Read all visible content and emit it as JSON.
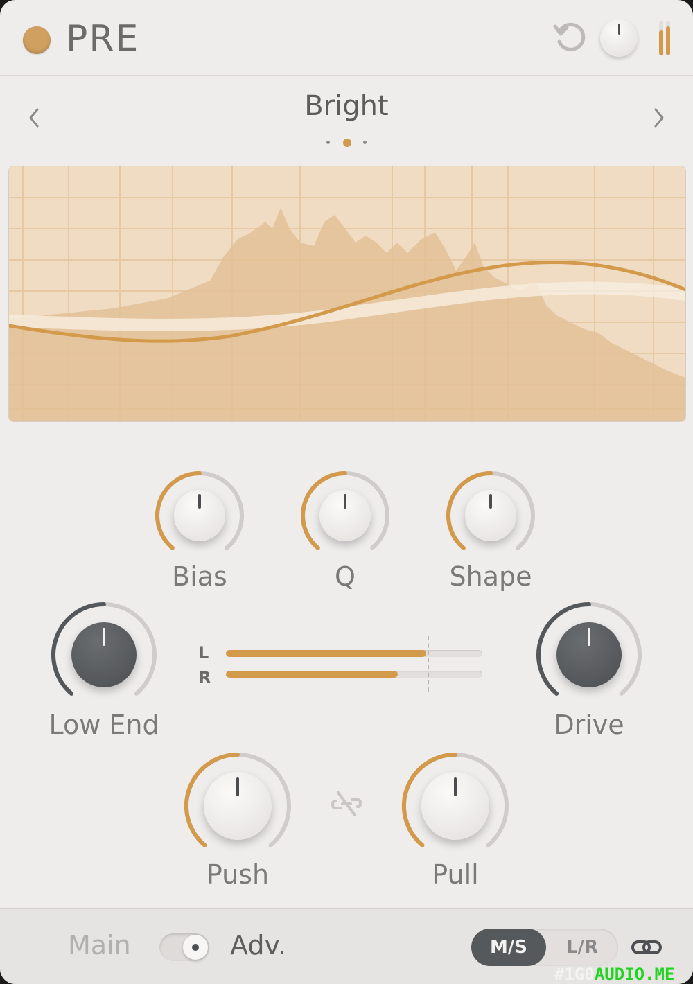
{
  "header": {
    "title": "PRE",
    "power_color": "#D0A060",
    "mix_knob_value": 0.5
  },
  "preset": {
    "name": "Bright",
    "page_count": 3,
    "active_page": 1,
    "prev_icon": "chevron-left-icon",
    "next_icon": "chevron-right-icon"
  },
  "controls": {
    "accent": "#D29A4A",
    "small_knobs": [
      {
        "label": "Bias",
        "value": 0.5
      },
      {
        "label": "Q",
        "value": 0.5
      },
      {
        "label": "Shape",
        "value": 0.5
      }
    ],
    "big_knobs": [
      {
        "label": "Low End",
        "value": 0.5
      },
      {
        "label": "Drive",
        "value": 0.5
      }
    ],
    "bottom_knobs": [
      {
        "label": "Push",
        "value": 0.5
      },
      {
        "label": "Pull",
        "value": 0.5
      }
    ]
  },
  "meter": {
    "left_label": "L",
    "right_label": "R",
    "left_level": 0.78,
    "right_level": 0.67,
    "peak": 0.79
  },
  "footer": {
    "main_label": "Main",
    "adv_label": "Adv.",
    "ms_label": "M/S",
    "lr_label": "L/R",
    "selected_mode": "M/S"
  },
  "watermark": {
    "prefix": "#1G0",
    "suffix": "AUDIO.ME"
  }
}
